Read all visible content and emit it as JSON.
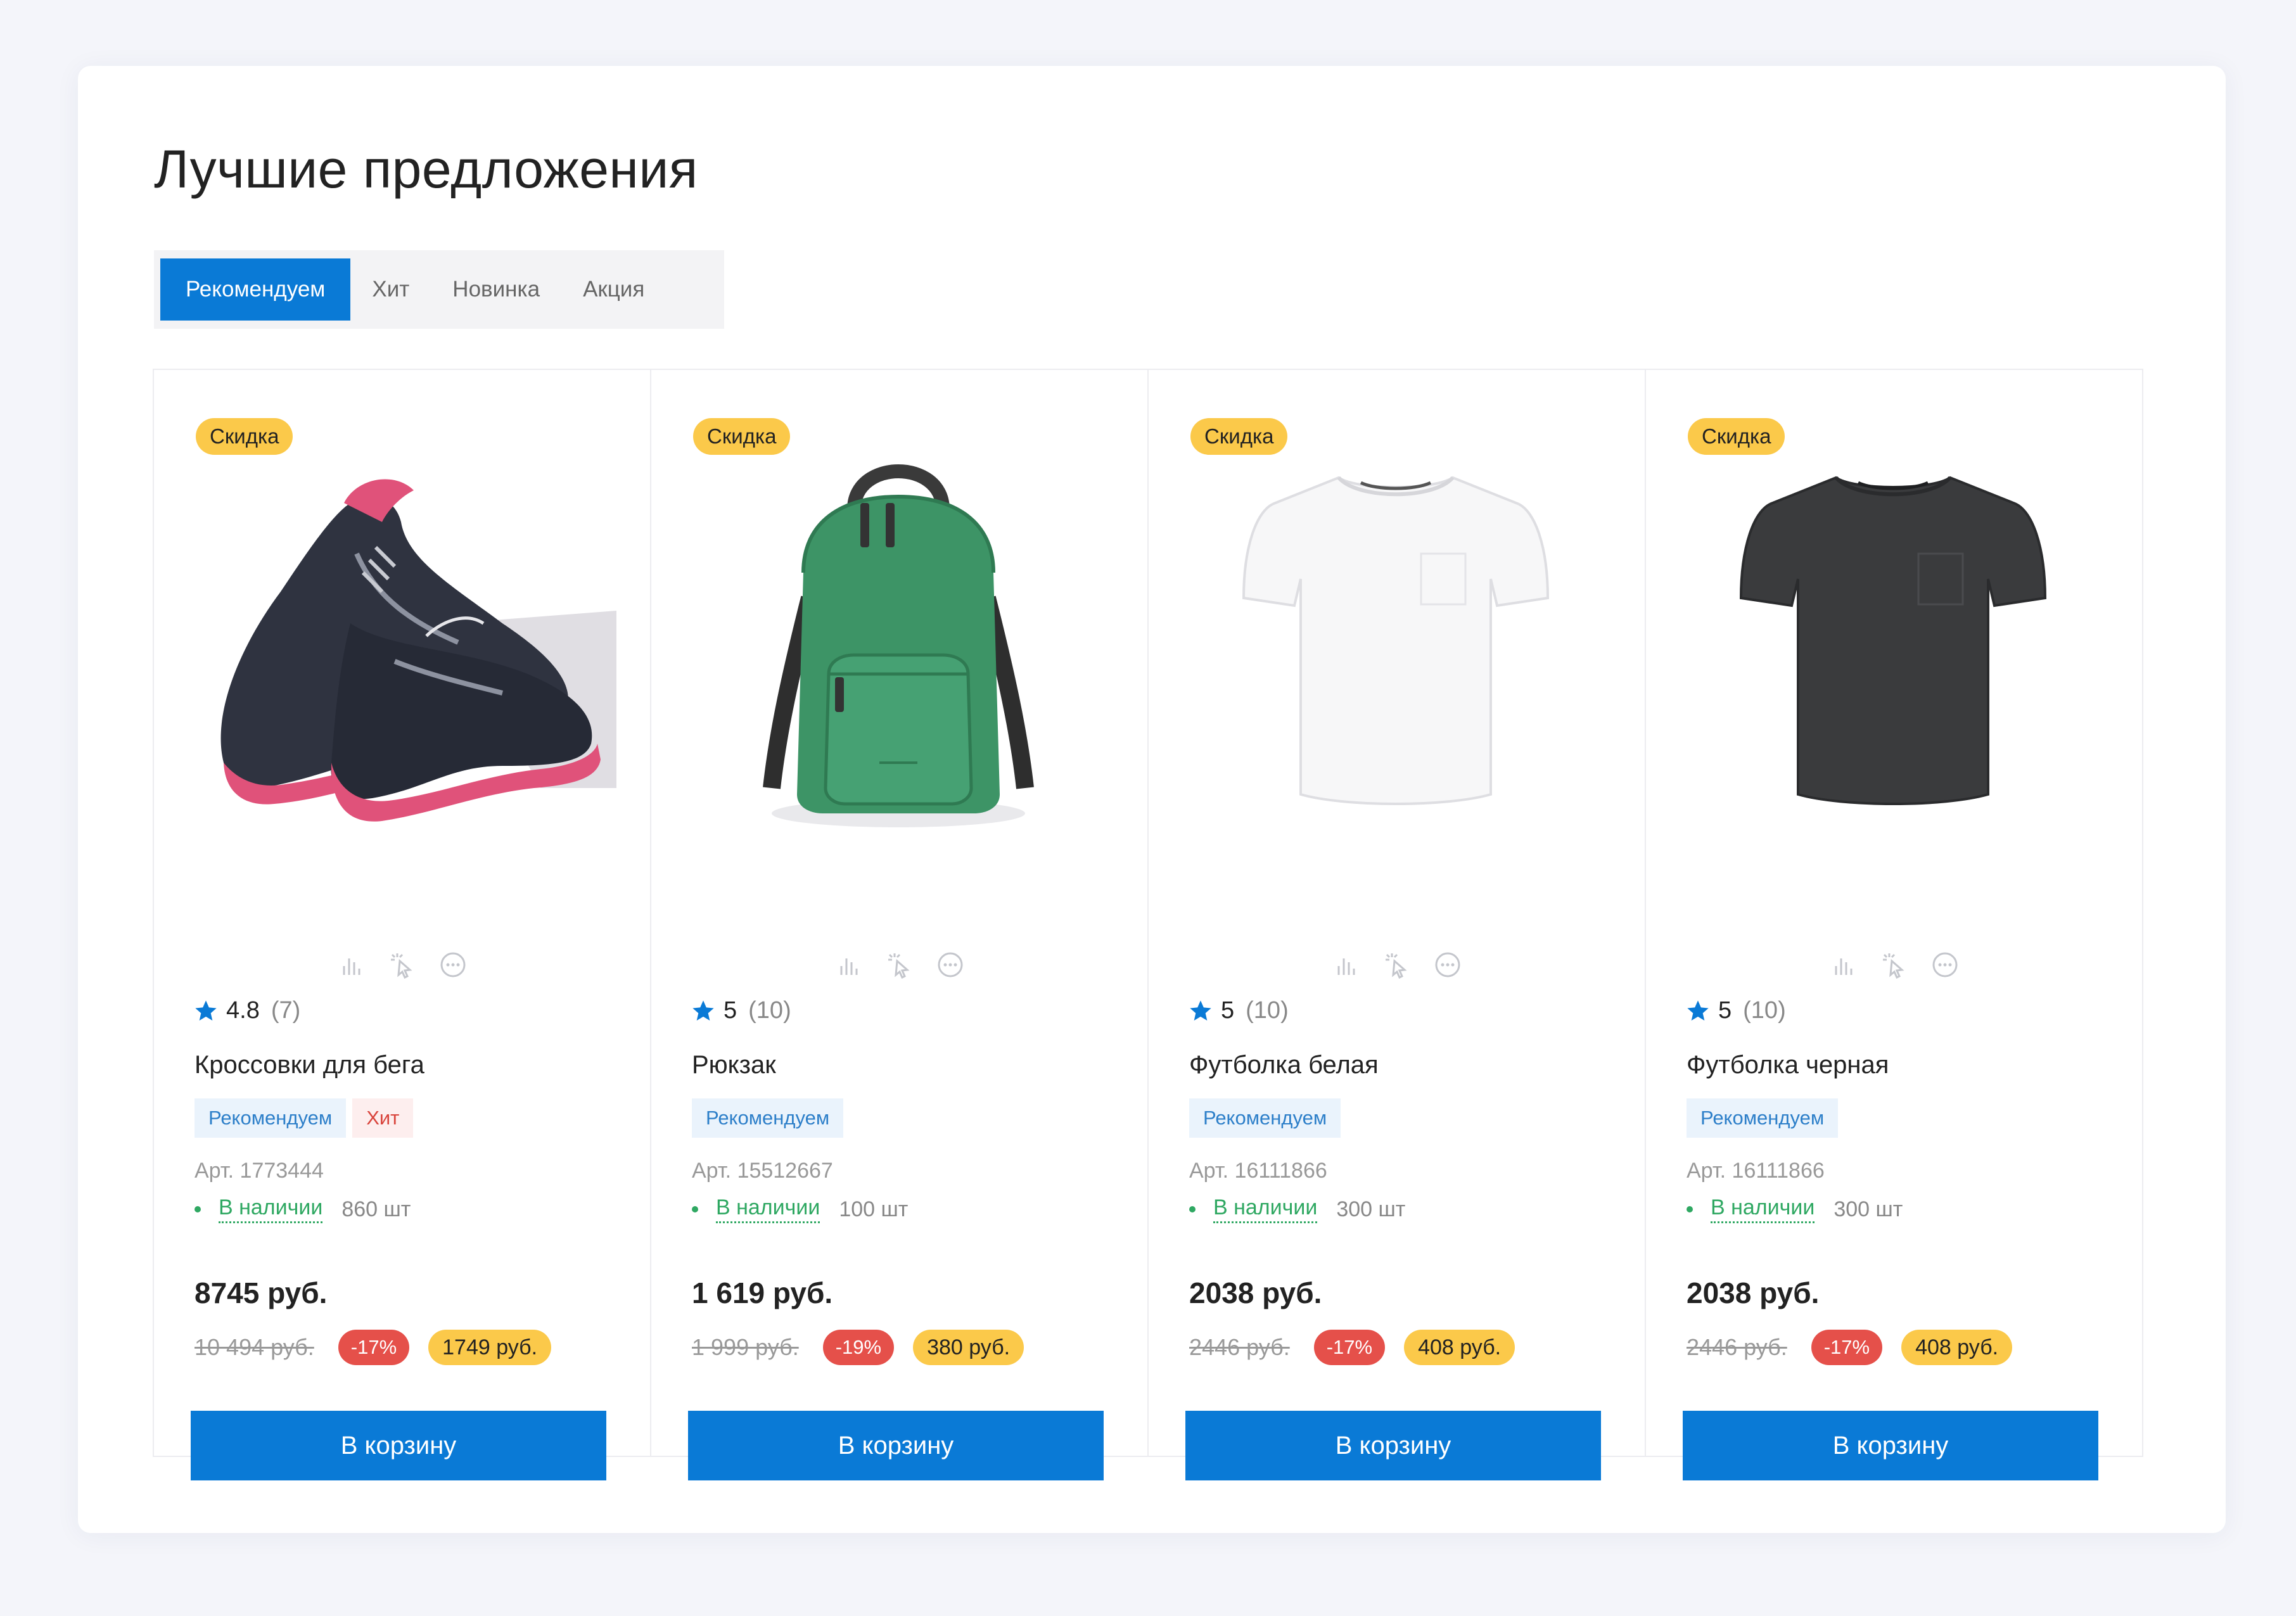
{
  "title": "Лучшие предложения",
  "tabs": [
    {
      "label": "Рекомендуем",
      "active": true
    },
    {
      "label": "Хит",
      "active": false
    },
    {
      "label": "Новинка",
      "active": false
    },
    {
      "label": "Акция",
      "active": false
    }
  ],
  "colors": {
    "primary": "#0a7ad6",
    "sale_badge": "#fbc94a",
    "discount": "#e5504a",
    "in_stock": "#2fa862"
  },
  "action_icons": [
    "chart-icon",
    "compare-cursor-icon",
    "more-icon"
  ],
  "products": [
    {
      "badge": "Скидка",
      "image": "running-shoes",
      "rating": "4.8",
      "reviews": "(7)",
      "name": "Кроссовки для бега",
      "tags": [
        {
          "label": "Рекомендуем",
          "type": "rec"
        },
        {
          "label": "Хит",
          "type": "hit"
        }
      ],
      "sku": "Арт. 1773444",
      "stock_label": "В наличии",
      "stock_qty": "860 шт",
      "price": "8745 руб.",
      "old_price": "10 494 руб.",
      "discount": "-17%",
      "saving": "1749 руб.",
      "cta": "В корзину"
    },
    {
      "badge": "Скидка",
      "image": "backpack",
      "rating": "5",
      "reviews": "(10)",
      "name": "Рюкзак",
      "tags": [
        {
          "label": "Рекомендуем",
          "type": "rec"
        }
      ],
      "sku": "Арт. 15512667",
      "stock_label": "В наличии",
      "stock_qty": "100 шт",
      "price": "1 619 руб.",
      "old_price": "1 999 руб.",
      "discount": "-19%",
      "saving": "380 руб.",
      "cta": "В корзину"
    },
    {
      "badge": "Скидка",
      "image": "white-tshirt",
      "rating": "5",
      "reviews": "(10)",
      "name": "Футболка белая",
      "tags": [
        {
          "label": "Рекомендуем",
          "type": "rec"
        }
      ],
      "sku": "Арт. 16111866",
      "stock_label": "В наличии",
      "stock_qty": "300 шт",
      "price": "2038 руб.",
      "old_price": "2446 руб.",
      "discount": "-17%",
      "saving": "408 руб.",
      "cta": "В корзину"
    },
    {
      "badge": "Скидка",
      "image": "black-tshirt",
      "rating": "5",
      "reviews": "(10)",
      "name": "Футболка черная",
      "tags": [
        {
          "label": "Рекомендуем",
          "type": "rec"
        }
      ],
      "sku": "Арт. 16111866",
      "stock_label": "В наличии",
      "stock_qty": "300 шт",
      "price": "2038 руб.",
      "old_price": "2446 руб.",
      "discount": "-17%",
      "saving": "408 руб.",
      "cta": "В корзину"
    }
  ]
}
